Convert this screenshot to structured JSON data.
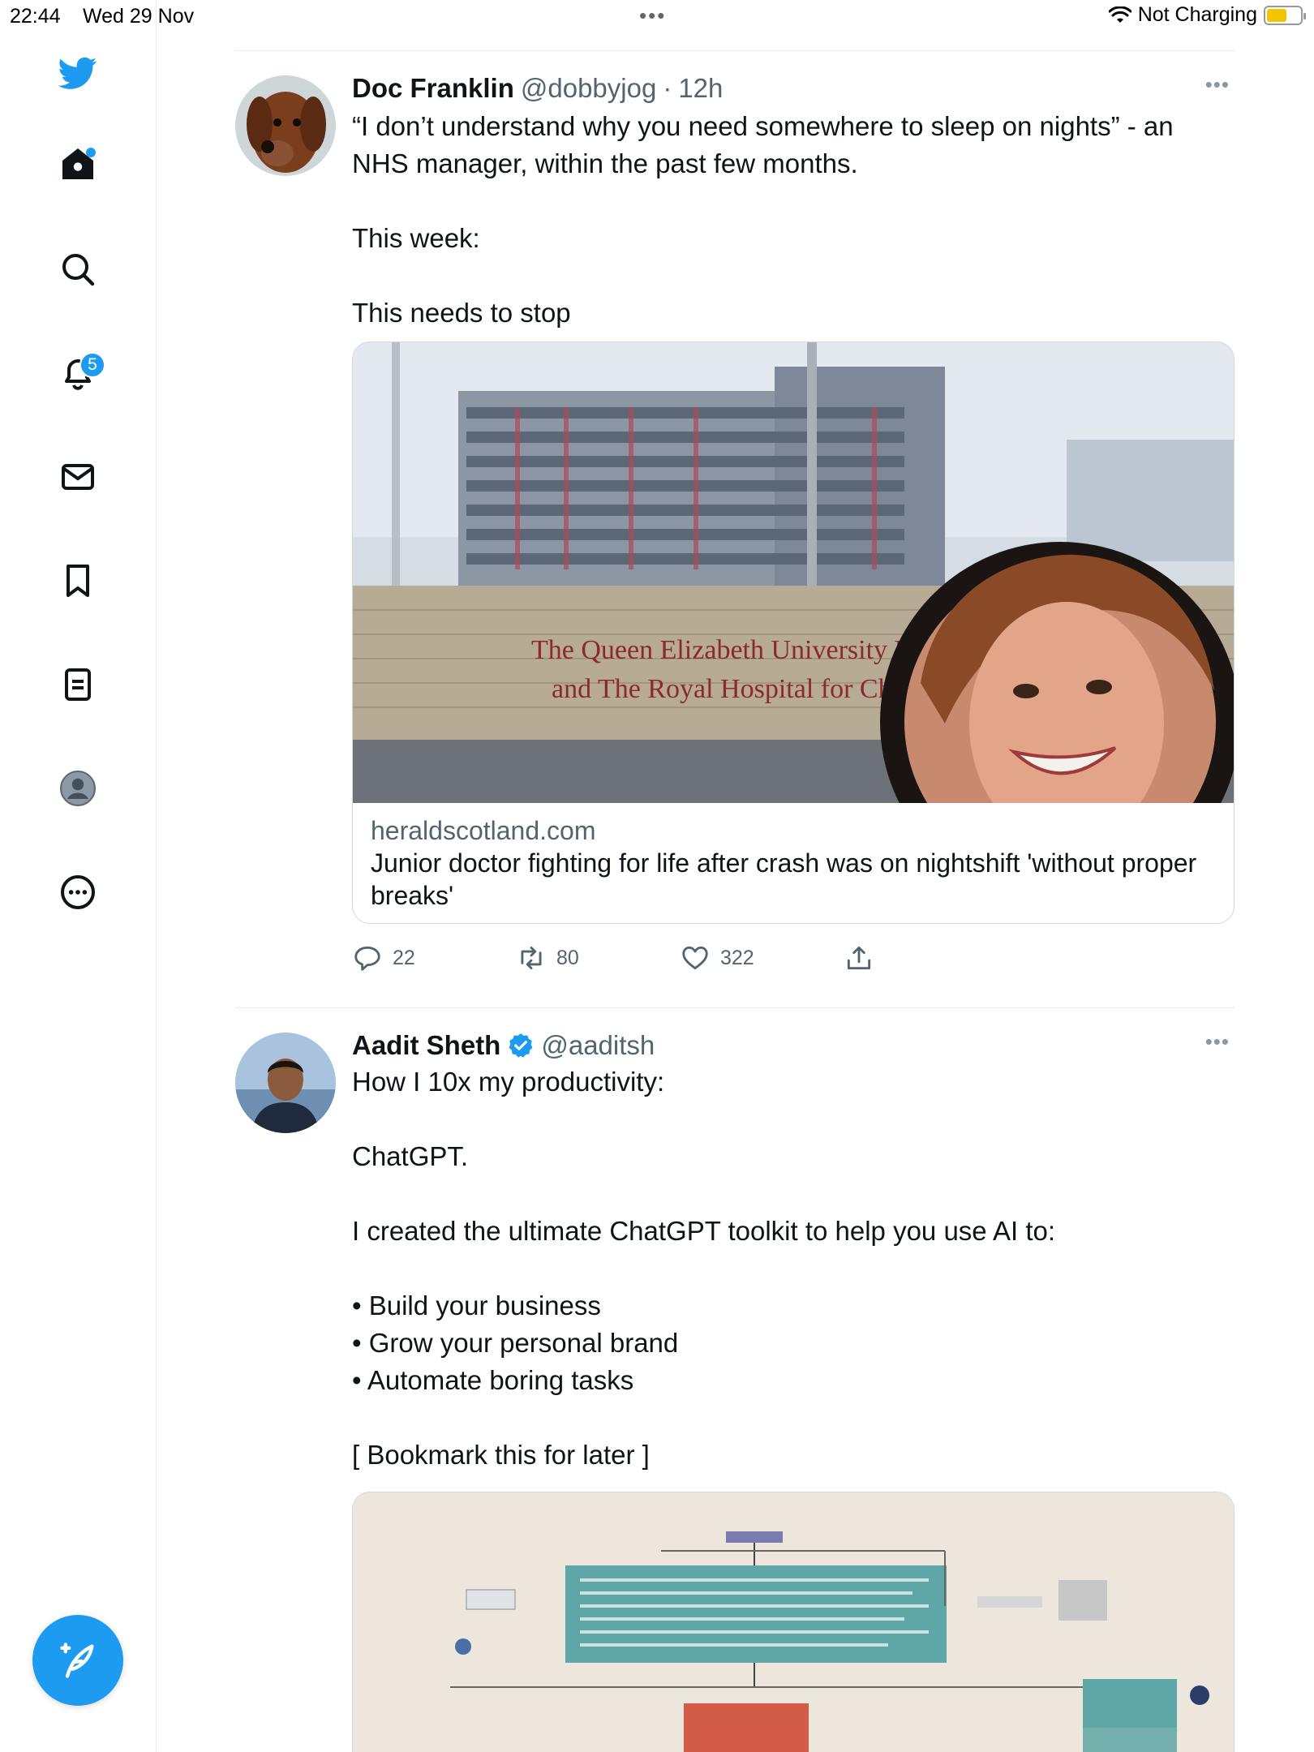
{
  "status_bar": {
    "time": "22:44",
    "date": "Wed 29 Nov",
    "battery_text": "Not Charging",
    "battery_color": "#f5c400"
  },
  "sidebar": {
    "items": [
      {
        "name": "home",
        "icon": "home-icon"
      },
      {
        "name": "explore",
        "icon": "search-icon"
      },
      {
        "name": "notifications",
        "icon": "bell-icon",
        "badge": "5"
      },
      {
        "name": "messages",
        "icon": "mail-icon"
      },
      {
        "name": "bookmarks",
        "icon": "bookmark-icon"
      },
      {
        "name": "lists",
        "icon": "list-icon"
      },
      {
        "name": "profile",
        "icon": "profile-icon"
      },
      {
        "name": "more",
        "icon": "more-circle-icon"
      }
    ],
    "accent": "#1d9bf0"
  },
  "tweets": [
    {
      "name": "Doc Franklin",
      "handle": "@dobbyjog",
      "separator": "·",
      "time": "12h",
      "text": [
        "“I don’t understand why you need somewhere to sleep on nights” - an NHS manager, within the past few months.",
        "",
        "This week:",
        "",
        "This needs to stop"
      ],
      "card": {
        "image_sign_line1": "The Queen Elizabeth University Hos",
        "image_sign_line2": "and The Royal Hospital for Childre",
        "domain": "heraldscotland.com",
        "title": "Junior doctor fighting for life after crash was on nightshift 'without proper breaks'"
      },
      "actions": {
        "replies": "22",
        "retweets": "80",
        "likes": "322"
      }
    },
    {
      "name": "Aadit Sheth",
      "handle": "@aaditsh",
      "verified": true,
      "text": [
        "How I 10x my productivity:",
        "",
        "ChatGPT.",
        "",
        "I created the ultimate ChatGPT toolkit to help you use AI to:",
        "",
        "• Build your business",
        "• Grow your personal brand",
        "• Automate boring tasks",
        "",
        "[ Bookmark this for later ]"
      ]
    }
  ]
}
